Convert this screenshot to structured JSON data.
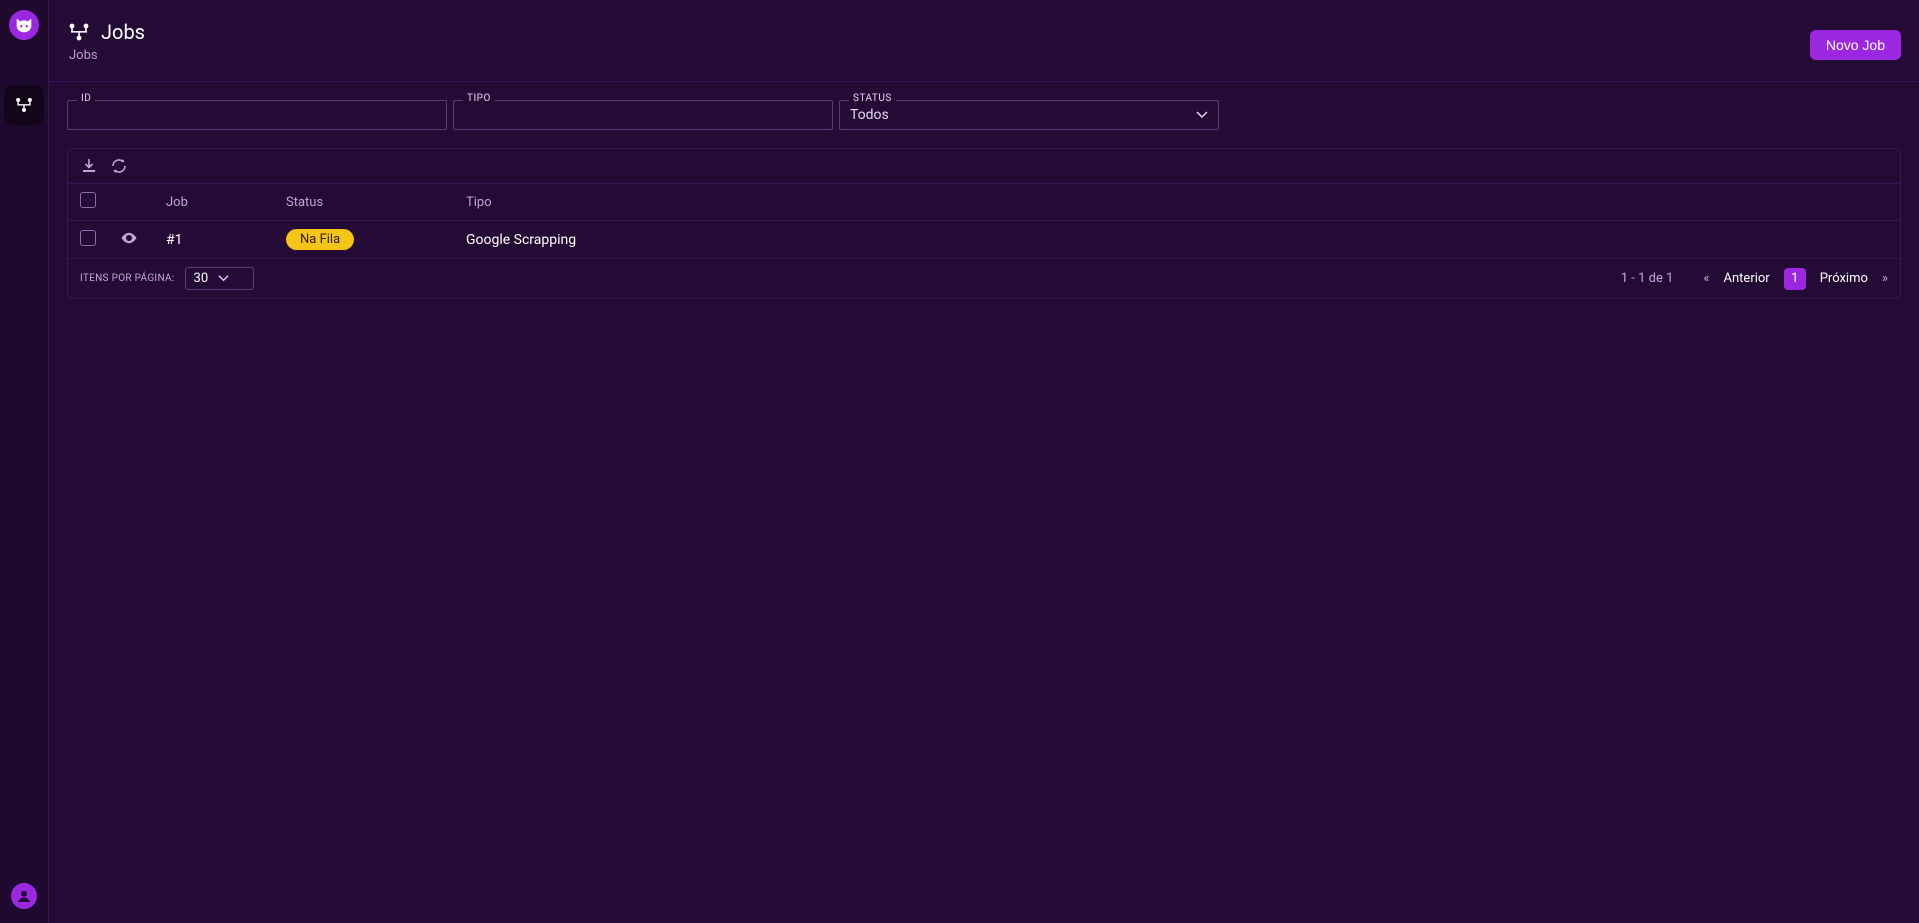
{
  "header": {
    "title": "Jobs",
    "breadcrumb": "Jobs",
    "new_button": "Novo Job"
  },
  "filters": {
    "id": {
      "label": "ID",
      "value": ""
    },
    "tipo": {
      "label": "TIPO",
      "value": ""
    },
    "status": {
      "label": "STATUS",
      "selected": "Todos"
    }
  },
  "table": {
    "columns": {
      "job": "Job",
      "status": "Status",
      "tipo": "Tipo"
    },
    "rows": [
      {
        "job": "#1",
        "status": "Na Fila",
        "tipo": "Google Scrapping"
      }
    ]
  },
  "pagination": {
    "items_per_page_label": "ITENS POR PÁGINA:",
    "items_per_page": "30",
    "range": "1 - 1 de 1",
    "prev": "Anterior",
    "next": "Próximo",
    "current": "1"
  }
}
